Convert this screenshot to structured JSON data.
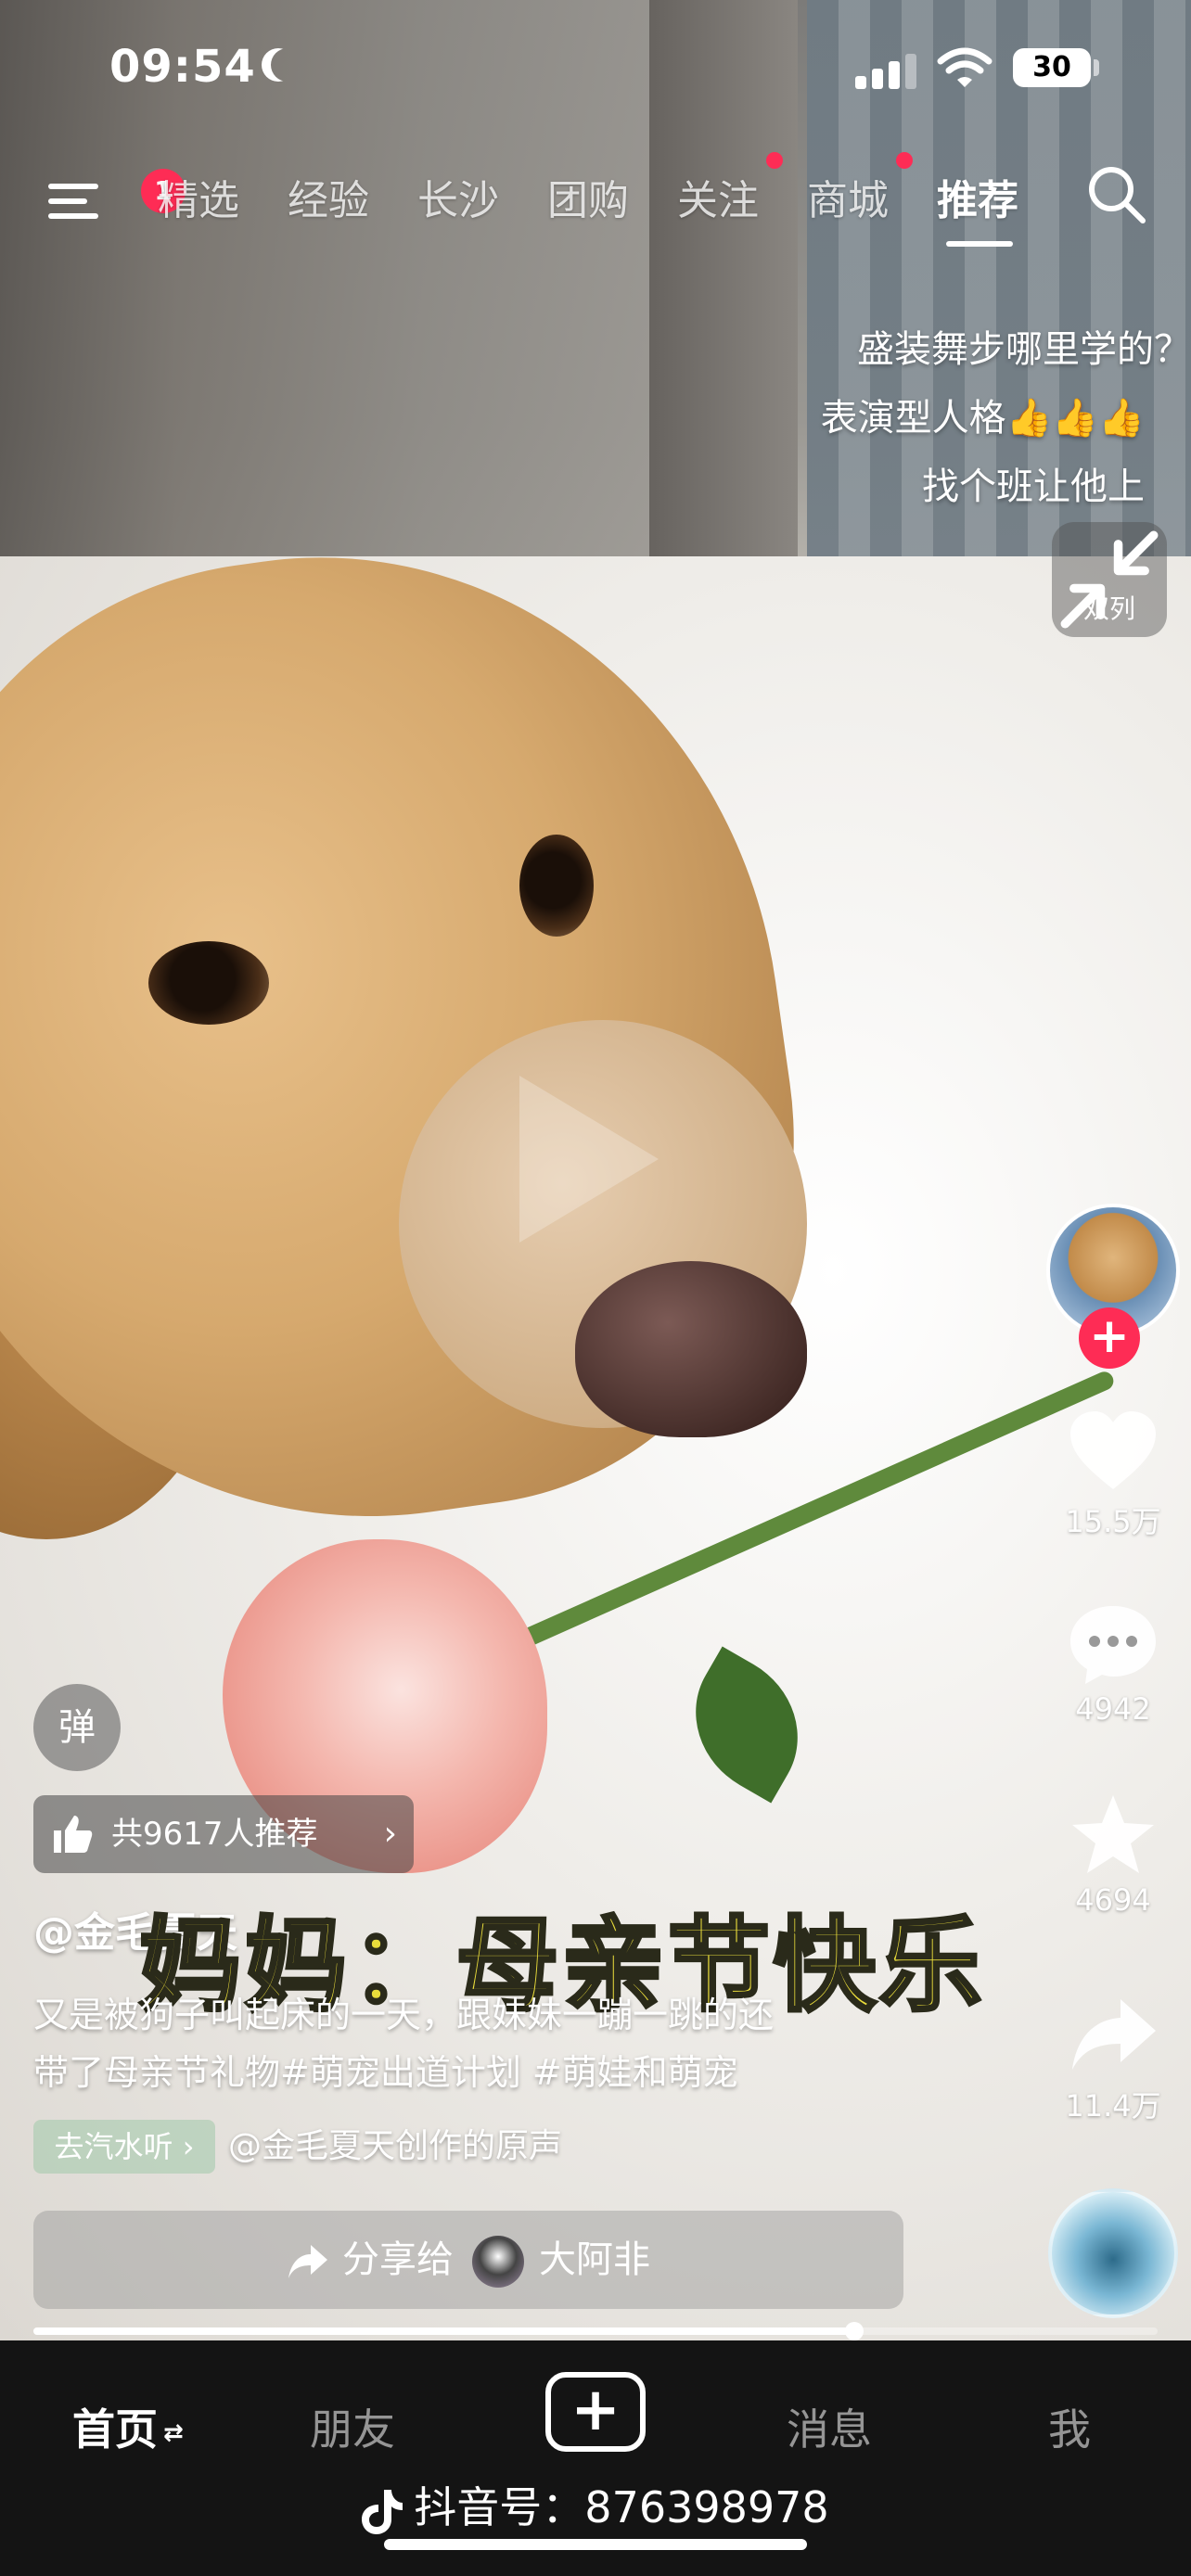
{
  "status_bar": {
    "time": "09:54",
    "battery": "30"
  },
  "top_nav": {
    "menu_badge": "1",
    "tabs": [
      "精选",
      "经验",
      "长沙",
      "团购",
      "关注",
      "商城",
      "推荐"
    ],
    "active_tab": "推荐"
  },
  "caption": {
    "lines": [
      "盛装舞步哪里学的？",
      "表演型人格👍👍👍",
      "找个班让他上"
    ],
    "dual_column_label": "双列"
  },
  "right_rail": {
    "likes": "15.5万",
    "comments": "4942",
    "favorites": "4694",
    "shares": "11.4万"
  },
  "bottom_info": {
    "danmu_label": "弹",
    "recommend": "共9617人推荐",
    "author": "@金毛夏天",
    "overlay_subtitle": "妈妈：母亲节快乐",
    "description_line1": "又是被狗子叫起床的一天，跟妹妹一蹦一跳的还",
    "description_line2": "带了母亲节礼物#萌宠出道计划 #萌娃和萌宠",
    "music_tag": "去汽水听",
    "music_text": "@金毛夏天创作的原声",
    "share_label": "分享给",
    "share_target": "大阿非",
    "progress": 0.73
  },
  "bottom_bar": {
    "tabs": [
      "首页",
      "朋友",
      "消息",
      "我"
    ],
    "douyin_id": "抖音号：876398978"
  }
}
